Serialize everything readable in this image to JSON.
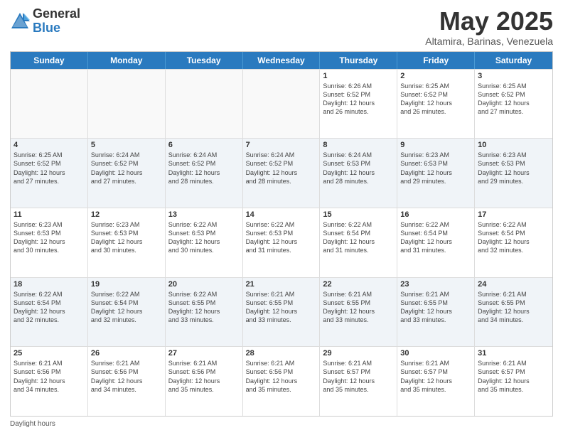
{
  "header": {
    "logo_general": "General",
    "logo_blue": "Blue",
    "title": "May 2025",
    "location": "Altamira, Barinas, Venezuela"
  },
  "days_of_week": [
    "Sunday",
    "Monday",
    "Tuesday",
    "Wednesday",
    "Thursday",
    "Friday",
    "Saturday"
  ],
  "footer": "Daylight hours",
  "weeks": [
    [
      {
        "day": "",
        "info": "",
        "empty": true
      },
      {
        "day": "",
        "info": "",
        "empty": true
      },
      {
        "day": "",
        "info": "",
        "empty": true
      },
      {
        "day": "",
        "info": "",
        "empty": true
      },
      {
        "day": "1",
        "info": "Sunrise: 6:26 AM\nSunset: 6:52 PM\nDaylight: 12 hours\nand 26 minutes."
      },
      {
        "day": "2",
        "info": "Sunrise: 6:25 AM\nSunset: 6:52 PM\nDaylight: 12 hours\nand 26 minutes."
      },
      {
        "day": "3",
        "info": "Sunrise: 6:25 AM\nSunset: 6:52 PM\nDaylight: 12 hours\nand 27 minutes."
      }
    ],
    [
      {
        "day": "4",
        "info": "Sunrise: 6:25 AM\nSunset: 6:52 PM\nDaylight: 12 hours\nand 27 minutes."
      },
      {
        "day": "5",
        "info": "Sunrise: 6:24 AM\nSunset: 6:52 PM\nDaylight: 12 hours\nand 27 minutes."
      },
      {
        "day": "6",
        "info": "Sunrise: 6:24 AM\nSunset: 6:52 PM\nDaylight: 12 hours\nand 28 minutes."
      },
      {
        "day": "7",
        "info": "Sunrise: 6:24 AM\nSunset: 6:52 PM\nDaylight: 12 hours\nand 28 minutes."
      },
      {
        "day": "8",
        "info": "Sunrise: 6:24 AM\nSunset: 6:53 PM\nDaylight: 12 hours\nand 28 minutes."
      },
      {
        "day": "9",
        "info": "Sunrise: 6:23 AM\nSunset: 6:53 PM\nDaylight: 12 hours\nand 29 minutes."
      },
      {
        "day": "10",
        "info": "Sunrise: 6:23 AM\nSunset: 6:53 PM\nDaylight: 12 hours\nand 29 minutes."
      }
    ],
    [
      {
        "day": "11",
        "info": "Sunrise: 6:23 AM\nSunset: 6:53 PM\nDaylight: 12 hours\nand 30 minutes."
      },
      {
        "day": "12",
        "info": "Sunrise: 6:23 AM\nSunset: 6:53 PM\nDaylight: 12 hours\nand 30 minutes."
      },
      {
        "day": "13",
        "info": "Sunrise: 6:22 AM\nSunset: 6:53 PM\nDaylight: 12 hours\nand 30 minutes."
      },
      {
        "day": "14",
        "info": "Sunrise: 6:22 AM\nSunset: 6:53 PM\nDaylight: 12 hours\nand 31 minutes."
      },
      {
        "day": "15",
        "info": "Sunrise: 6:22 AM\nSunset: 6:54 PM\nDaylight: 12 hours\nand 31 minutes."
      },
      {
        "day": "16",
        "info": "Sunrise: 6:22 AM\nSunset: 6:54 PM\nDaylight: 12 hours\nand 31 minutes."
      },
      {
        "day": "17",
        "info": "Sunrise: 6:22 AM\nSunset: 6:54 PM\nDaylight: 12 hours\nand 32 minutes."
      }
    ],
    [
      {
        "day": "18",
        "info": "Sunrise: 6:22 AM\nSunset: 6:54 PM\nDaylight: 12 hours\nand 32 minutes."
      },
      {
        "day": "19",
        "info": "Sunrise: 6:22 AM\nSunset: 6:54 PM\nDaylight: 12 hours\nand 32 minutes."
      },
      {
        "day": "20",
        "info": "Sunrise: 6:22 AM\nSunset: 6:55 PM\nDaylight: 12 hours\nand 33 minutes."
      },
      {
        "day": "21",
        "info": "Sunrise: 6:21 AM\nSunset: 6:55 PM\nDaylight: 12 hours\nand 33 minutes."
      },
      {
        "day": "22",
        "info": "Sunrise: 6:21 AM\nSunset: 6:55 PM\nDaylight: 12 hours\nand 33 minutes."
      },
      {
        "day": "23",
        "info": "Sunrise: 6:21 AM\nSunset: 6:55 PM\nDaylight: 12 hours\nand 33 minutes."
      },
      {
        "day": "24",
        "info": "Sunrise: 6:21 AM\nSunset: 6:55 PM\nDaylight: 12 hours\nand 34 minutes."
      }
    ],
    [
      {
        "day": "25",
        "info": "Sunrise: 6:21 AM\nSunset: 6:56 PM\nDaylight: 12 hours\nand 34 minutes."
      },
      {
        "day": "26",
        "info": "Sunrise: 6:21 AM\nSunset: 6:56 PM\nDaylight: 12 hours\nand 34 minutes."
      },
      {
        "day": "27",
        "info": "Sunrise: 6:21 AM\nSunset: 6:56 PM\nDaylight: 12 hours\nand 35 minutes."
      },
      {
        "day": "28",
        "info": "Sunrise: 6:21 AM\nSunset: 6:56 PM\nDaylight: 12 hours\nand 35 minutes."
      },
      {
        "day": "29",
        "info": "Sunrise: 6:21 AM\nSunset: 6:57 PM\nDaylight: 12 hours\nand 35 minutes."
      },
      {
        "day": "30",
        "info": "Sunrise: 6:21 AM\nSunset: 6:57 PM\nDaylight: 12 hours\nand 35 minutes."
      },
      {
        "day": "31",
        "info": "Sunrise: 6:21 AM\nSunset: 6:57 PM\nDaylight: 12 hours\nand 35 minutes."
      }
    ]
  ]
}
